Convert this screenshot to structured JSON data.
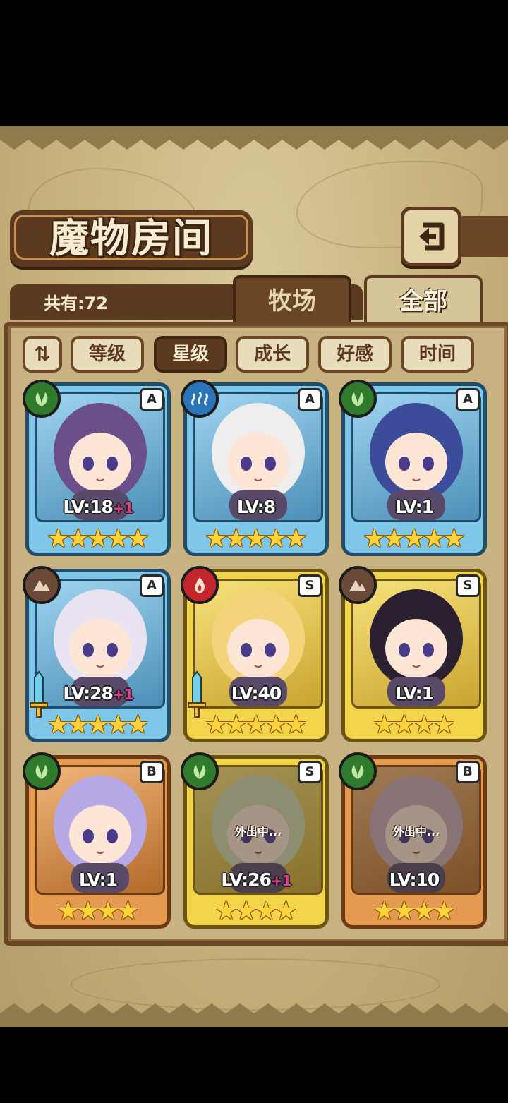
{
  "title": "魔物房间",
  "count_label": "共有:72",
  "tabs": [
    {
      "label": "牧场",
      "active": false
    },
    {
      "label": "全部",
      "active": true
    }
  ],
  "sort": {
    "order_icon": "sort-order-icon",
    "buttons": [
      {
        "label": "等级",
        "active": false
      },
      {
        "label": "星级",
        "active": true
      },
      {
        "label": "成长",
        "active": false
      },
      {
        "label": "好感",
        "active": false
      },
      {
        "label": "时间",
        "active": false
      }
    ]
  },
  "monsters": [
    {
      "rank": "A",
      "element": "nature",
      "lv": "LV:18",
      "plus": "+1",
      "stars": 5,
      "weapon": false,
      "away": false
    },
    {
      "rank": "A",
      "element": "water",
      "lv": "LV:8",
      "plus": "",
      "stars": 5,
      "weapon": false,
      "away": false
    },
    {
      "rank": "A",
      "element": "nature",
      "lv": "LV:1",
      "plus": "",
      "stars": 5,
      "weapon": false,
      "away": false
    },
    {
      "rank": "A",
      "element": "earth",
      "lv": "LV:28",
      "plus": "+1",
      "stars": 5,
      "weapon": true,
      "away": false
    },
    {
      "rank": "S",
      "element": "fire",
      "lv": "LV:40",
      "plus": "",
      "stars": 5,
      "weapon": true,
      "away": false
    },
    {
      "rank": "S",
      "element": "earth",
      "lv": "LV:1",
      "plus": "",
      "stars": 4,
      "weapon": false,
      "away": false
    },
    {
      "rank": "B",
      "element": "nature",
      "lv": "LV:1",
      "plus": "",
      "stars": 4,
      "weapon": false,
      "away": false
    },
    {
      "rank": "S",
      "element": "nature",
      "lv": "LV:26",
      "plus": "+1",
      "stars": 4,
      "weapon": false,
      "away": true,
      "away_text": "外出中..."
    },
    {
      "rank": "B",
      "element": "nature",
      "lv": "LV:10",
      "plus": "",
      "stars": 4,
      "weapon": false,
      "away": true,
      "away_text": "外出中..."
    }
  ],
  "colors": {
    "wood": "#5b3a1f",
    "parchment": "#c7b27d",
    "rank_A": "#7ec7e8",
    "rank_S": "#f2d54b",
    "rank_B": "#e59a52"
  }
}
